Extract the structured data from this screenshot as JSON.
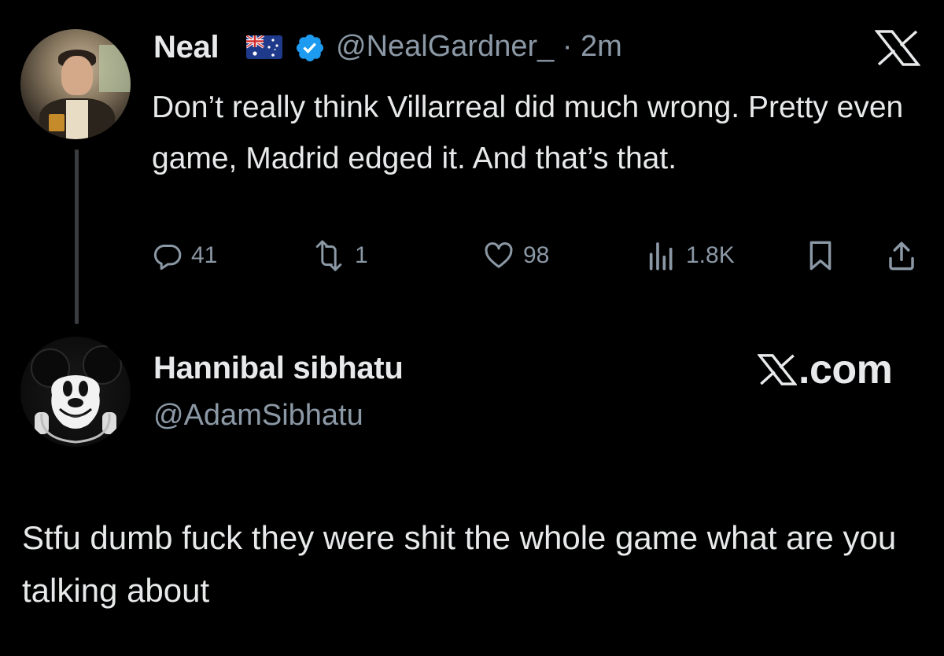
{
  "tweet": {
    "author_name": "Neal",
    "handle_time": "@NealGardner_ · 2m",
    "flag_icon": "australia-flag-icon",
    "verified_icon": "verified-badge-icon",
    "verified_color": "#1d9bf0",
    "text": "Don’t really think Villarreal did much wrong. Pretty even game, Madrid edged it. And that’s that.",
    "metrics": {
      "replies": "41",
      "retweets": "1",
      "likes": "98",
      "views": "1.8K"
    }
  },
  "reply": {
    "author_name": "Hannibal sibhatu",
    "handle": "@AdamSibhatu",
    "source_label": ".com",
    "text": "Stfu dumb fuck they were shit the whole game what are you talking about"
  },
  "colors": {
    "background": "#000000",
    "primary_text": "#e7e9ea",
    "secondary_text": "#8b98a5",
    "thread_line": "#3a3d40"
  }
}
